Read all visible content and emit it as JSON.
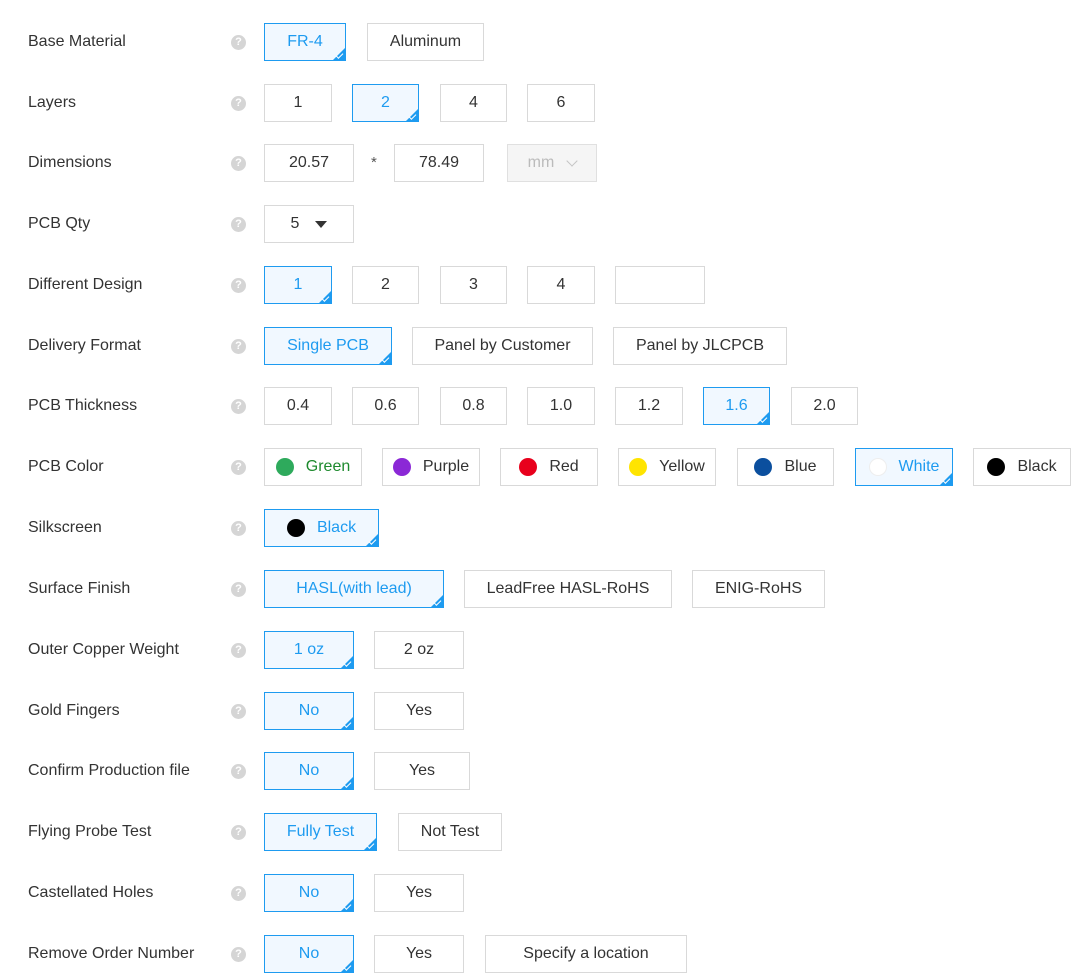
{
  "help_glyph": "?",
  "base_material": {
    "label": "Base Material",
    "options": [
      "FR-4",
      "Aluminum"
    ],
    "selected": "FR-4"
  },
  "layers": {
    "label": "Layers",
    "options": [
      "1",
      "2",
      "4",
      "6"
    ],
    "selected": "2"
  },
  "dimensions": {
    "label": "Dimensions",
    "width": "20.57",
    "separator": "*",
    "height": "78.49",
    "unit": "mm"
  },
  "pcb_qty": {
    "label": "PCB Qty",
    "value": "5"
  },
  "different_design": {
    "label": "Different Design",
    "options": [
      "1",
      "2",
      "3",
      "4"
    ],
    "selected": "1",
    "custom_value": ""
  },
  "delivery_format": {
    "label": "Delivery Format",
    "options": [
      "Single PCB",
      "Panel by Customer",
      "Panel by JLCPCB"
    ],
    "selected": "Single PCB"
  },
  "pcb_thickness": {
    "label": "PCB Thickness",
    "options": [
      "0.4",
      "0.6",
      "0.8",
      "1.0",
      "1.2",
      "1.6",
      "2.0"
    ],
    "selected": "1.6"
  },
  "pcb_color": {
    "label": "PCB Color",
    "options": [
      {
        "name": "Green",
        "swatch": "#2eaa5c",
        "text_color": "#1e8a2e"
      },
      {
        "name": "Purple",
        "swatch": "#8b28d6"
      },
      {
        "name": "Red",
        "swatch": "#e8001c"
      },
      {
        "name": "Yellow",
        "swatch": "#ffe400"
      },
      {
        "name": "Blue",
        "swatch": "#0b4f9e"
      },
      {
        "name": "White",
        "swatch": "#ffffff"
      },
      {
        "name": "Black",
        "swatch": "#000000"
      }
    ],
    "selected": "White"
  },
  "silkscreen": {
    "label": "Silkscreen",
    "options": [
      {
        "name": "Black",
        "swatch": "#000000"
      }
    ],
    "selected": "Black"
  },
  "surface_finish": {
    "label": "Surface Finish",
    "options": [
      "HASL(with lead)",
      "LeadFree HASL-RoHS",
      "ENIG-RoHS"
    ],
    "selected": "HASL(with lead)"
  },
  "outer_copper_weight": {
    "label": "Outer Copper Weight",
    "options": [
      "1 oz",
      "2 oz"
    ],
    "selected": "1 oz"
  },
  "gold_fingers": {
    "label": "Gold Fingers",
    "options": [
      "No",
      "Yes"
    ],
    "selected": "No"
  },
  "confirm_production_file": {
    "label": "Confirm Production file",
    "options": [
      "No",
      "Yes"
    ],
    "selected": "No"
  },
  "flying_probe_test": {
    "label": "Flying Probe Test",
    "options": [
      "Fully Test",
      "Not Test"
    ],
    "selected": "Fully Test"
  },
  "castellated_holes": {
    "label": "Castellated Holes",
    "options": [
      "No",
      "Yes"
    ],
    "selected": "No"
  },
  "remove_order_number": {
    "label": "Remove Order Number",
    "options": [
      "No",
      "Yes",
      "Specify a location"
    ],
    "selected": "No"
  },
  "colors": {
    "accent": "#1e9bf0",
    "selected_bg": "#f1f8ff",
    "border": "#d9d9d9"
  }
}
